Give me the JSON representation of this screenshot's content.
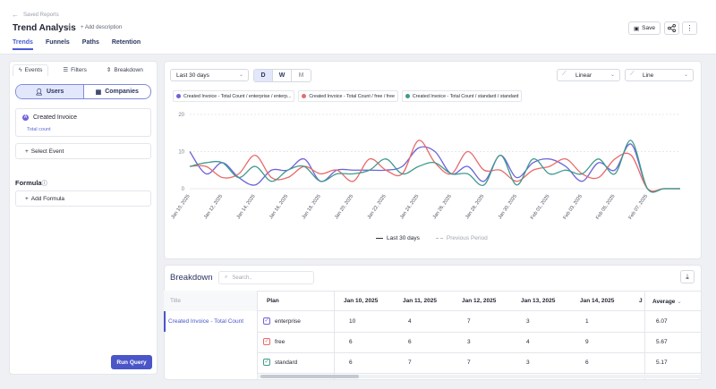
{
  "header": {
    "back_label": "Saved Reports",
    "title": "Trend Analysis",
    "add_description": "Add description",
    "tabs": [
      {
        "label": "Trends",
        "active": true
      },
      {
        "label": "Funnels",
        "active": false
      },
      {
        "label": "Paths",
        "active": false
      },
      {
        "label": "Retention",
        "active": false
      }
    ],
    "save_label": "Save"
  },
  "left_panel": {
    "tabs": [
      {
        "label": "Events",
        "active": true
      },
      {
        "label": "Filters",
        "active": false
      },
      {
        "label": "Breakdown",
        "active": false
      }
    ],
    "toggle": {
      "users": "Users",
      "companies": "Companies",
      "selected": "Users"
    },
    "event": {
      "badge": "A",
      "name": "Created Invoice",
      "metric": "Total count"
    },
    "select_event": "Select Event",
    "formula_label": "Formula",
    "add_formula": "Add Formula",
    "run_query": "Run Query"
  },
  "chart_controls": {
    "date_range": "Last 30 days",
    "granularity": [
      {
        "label": "D",
        "active": true
      },
      {
        "label": "W",
        "active": false
      },
      {
        "label": "M",
        "active": false
      }
    ],
    "scale": "Linear",
    "chart_type": "Line"
  },
  "legend_chips": [
    {
      "label": "Created Invoice - Total Count / enterprise / enterp...",
      "color": "#6c63d9"
    },
    {
      "label": "Created Invoice - Total Count / free / free",
      "color": "#e86a6a"
    },
    {
      "label": "Created Invoice - Total Count / standard / standard",
      "color": "#3e9a8c"
    }
  ],
  "bottom_legend": {
    "current": "Last 30 days",
    "previous": "Previous Period"
  },
  "colors": {
    "accent": "#4a56c8",
    "enterprise": "#6c63d9",
    "free": "#e86a6a",
    "standard": "#3e9a8c"
  },
  "chart_data": {
    "type": "line",
    "x": [
      "Jan 10, 2025",
      "Jan 11, 2025",
      "Jan 12, 2025",
      "Jan 13, 2025",
      "Jan 14, 2025",
      "Jan 15, 2025",
      "Jan 16, 2025",
      "Jan 17, 2025",
      "Jan 18, 2025",
      "Jan 19, 2025",
      "Jan 20, 2025",
      "Jan 21, 2025",
      "Jan 22, 2025",
      "Jan 23, 2025",
      "Jan 24, 2025",
      "Jan 25, 2025",
      "Jan 26, 2025",
      "Jan 27, 2025",
      "Jan 28, 2025",
      "Jan 29, 2025",
      "Jan 30, 2025",
      "Jan 31, 2025",
      "Feb 01, 2025",
      "Feb 02, 2025",
      "Feb 03, 2025",
      "Feb 04, 2025",
      "Feb 05, 2025",
      "Feb 06, 2025",
      "Feb 07, 2025",
      "Feb 08, 2025",
      "Feb 09, 2025"
    ],
    "x_tick_labels": [
      "Jan 10, 2025",
      "Jan 12, 2025",
      "Jan 14, 2025",
      "Jan 16, 2025",
      "Jan 18, 2025",
      "Jan 20, 2025",
      "Jan 22, 2025",
      "Jan 24, 2025",
      "Jan 26, 2025",
      "Jan 28, 2025",
      "Jan 30, 2025",
      "Feb 01, 2025",
      "Feb 03, 2025",
      "Feb 05, 2025",
      "Feb 07, 2025"
    ],
    "y_ticks": [
      0,
      10,
      20
    ],
    "ylim": [
      0,
      20
    ],
    "series": [
      {
        "name": "Created Invoice - Total Count / enterprise / enterp...",
        "values": [
          10,
          4,
          7,
          3,
          1,
          5,
          5,
          8,
          2,
          5,
          5,
          5,
          5,
          6,
          11,
          10,
          4,
          6,
          2,
          9,
          3,
          7,
          8,
          6,
          2,
          7,
          5,
          12,
          0,
          0,
          0
        ]
      },
      {
        "name": "Created Invoice - Total Count / free / free",
        "values": [
          6,
          6,
          3,
          4,
          9,
          3,
          3,
          6,
          4,
          5,
          2,
          8,
          5,
          4,
          13,
          7,
          4,
          10,
          5,
          5,
          2,
          5,
          6,
          8,
          4,
          3,
          8,
          9,
          0,
          0,
          0
        ]
      },
      {
        "name": "Created Invoice - Total Count / standard / standard",
        "values": [
          6,
          7,
          7,
          3,
          6,
          2,
          5,
          6,
          2,
          4,
          4,
          5,
          8,
          4,
          6,
          7,
          4,
          4,
          1,
          9,
          1,
          8,
          4,
          5,
          4,
          8,
          4,
          13,
          0,
          0,
          0
        ]
      }
    ]
  },
  "breakdown": {
    "title": "Breakdown",
    "search_placeholder": "Search..",
    "col_title": "Title",
    "col_plan": "Plan",
    "date_cols": [
      "Jan 10, 2025",
      "Jan 11, 2025",
      "Jan 12, 2025",
      "Jan 13, 2025",
      "Jan 14, 2025"
    ],
    "truncated_col": "J",
    "col_average": "Average",
    "row_title": "Created Invoice - Total Count",
    "rows": [
      {
        "plan": "enterprise",
        "values": [
          "10",
          "4",
          "7",
          "3",
          "1"
        ],
        "average": "6.07",
        "color": "#6c63d9"
      },
      {
        "plan": "free",
        "values": [
          "6",
          "6",
          "3",
          "4",
          "9"
        ],
        "average": "5.67",
        "color": "#e86a6a"
      },
      {
        "plan": "standard",
        "values": [
          "6",
          "7",
          "7",
          "3",
          "6"
        ],
        "average": "5.17",
        "color": "#3e9a8c"
      }
    ]
  }
}
